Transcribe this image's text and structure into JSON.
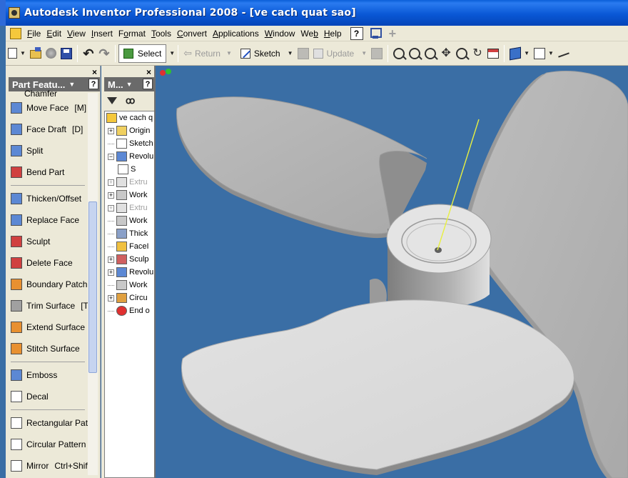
{
  "window": {
    "title": "Autodesk Inventor Professional 2008 - [ve cach quat sao]"
  },
  "menubar": {
    "items": [
      {
        "label": "File",
        "key": "F"
      },
      {
        "label": "Edit",
        "key": "E"
      },
      {
        "label": "View",
        "key": "V"
      },
      {
        "label": "Insert",
        "key": "I"
      },
      {
        "label": "Format",
        "key": "o"
      },
      {
        "label": "Tools",
        "key": "T"
      },
      {
        "label": "Convert",
        "key": "C"
      },
      {
        "label": "Applications",
        "key": "A"
      },
      {
        "label": "Window",
        "key": "W"
      },
      {
        "label": "Web",
        "key": "b"
      },
      {
        "label": "Help",
        "key": "H"
      }
    ],
    "help_button": "?"
  },
  "toolbar": {
    "select_label": "Select",
    "return_label": "Return",
    "sketch_label": "Sketch",
    "update_label": "Update"
  },
  "part_features": {
    "header": "Part Featu...",
    "help": "?",
    "partial_top": "Chamfer    Ctrl+Sh",
    "groups": [
      [
        {
          "label": "Move Face",
          "shortcut": "[M]",
          "icon": "move-face-icon",
          "color": "blue"
        },
        {
          "label": "Face Draft",
          "shortcut": "[D]",
          "icon": "face-draft-icon",
          "color": "blue"
        },
        {
          "label": "Split",
          "shortcut": "",
          "icon": "split-icon",
          "color": "blue"
        },
        {
          "label": "Bend Part",
          "shortcut": "",
          "icon": "bend-part-icon",
          "color": "red"
        }
      ],
      [
        {
          "label": "Thicken/Offset",
          "shortcut": "",
          "icon": "thicken-offset-icon",
          "color": "blue"
        },
        {
          "label": "Replace Face",
          "shortcut": "",
          "icon": "replace-face-icon",
          "color": "blue"
        },
        {
          "label": "Sculpt",
          "shortcut": "",
          "icon": "sculpt-icon",
          "color": "red"
        },
        {
          "label": "Delete Face",
          "shortcut": "",
          "icon": "delete-face-icon",
          "color": "red"
        },
        {
          "label": "Boundary Patch",
          "shortcut": "",
          "icon": "boundary-patch-icon",
          "color": "orange"
        },
        {
          "label": "Trim Surface",
          "shortcut": "[T]",
          "icon": "trim-surface-icon",
          "color": "gray"
        },
        {
          "label": "Extend Surface",
          "shortcut": "",
          "icon": "extend-surface-icon",
          "color": "orange"
        },
        {
          "label": "Stitch Surface",
          "shortcut": "",
          "icon": "stitch-surface-icon",
          "color": "orange"
        }
      ],
      [
        {
          "label": "Emboss",
          "shortcut": "",
          "icon": "emboss-icon",
          "color": "blue"
        },
        {
          "label": "Decal",
          "shortcut": "",
          "icon": "decal-icon",
          "color": "white"
        }
      ],
      [
        {
          "label": "Rectangular Patte",
          "shortcut": "",
          "icon": "rectangular-pattern-icon",
          "color": "white"
        },
        {
          "label": "Circular Pattern",
          "shortcut": "",
          "icon": "circular-pattern-icon",
          "color": "white"
        },
        {
          "label": "Mirror",
          "shortcut": "Ctrl+Shift",
          "icon": "mirror-icon",
          "color": "white"
        }
      ]
    ]
  },
  "browser": {
    "header": "M...",
    "help": "?",
    "items": [
      {
        "label": "ve cach q",
        "icon": "doc",
        "expander": "none",
        "dim": false,
        "sub": false
      },
      {
        "label": "Origin",
        "icon": "folder",
        "expander": "+",
        "dim": false,
        "sub": false
      },
      {
        "label": "Sketch",
        "icon": "sketch",
        "expander": "none",
        "dim": false,
        "sub": false
      },
      {
        "label": "Revolu",
        "icon": "revolve",
        "expander": "-",
        "dim": false,
        "sub": false
      },
      {
        "label": "S",
        "icon": "sketch",
        "expander": "",
        "dim": false,
        "sub": true
      },
      {
        "label": "Extru",
        "icon": "extrude",
        "expander": "+",
        "dim": true,
        "sub": false
      },
      {
        "label": "Work",
        "icon": "work",
        "expander": "+",
        "dim": false,
        "sub": false
      },
      {
        "label": "Extru",
        "icon": "extrude",
        "expander": "+",
        "dim": true,
        "sub": false
      },
      {
        "label": "Work",
        "icon": "work",
        "expander": "none",
        "dim": false,
        "sub": false
      },
      {
        "label": "Thick",
        "icon": "thick",
        "expander": "none",
        "dim": false,
        "sub": false
      },
      {
        "label": "FaceI",
        "icon": "face",
        "expander": "none",
        "dim": false,
        "sub": false
      },
      {
        "label": "Sculp",
        "icon": "sculpt",
        "expander": "+",
        "dim": false,
        "sub": false
      },
      {
        "label": "Revolu",
        "icon": "revolve",
        "expander": "+",
        "dim": false,
        "sub": false
      },
      {
        "label": "Work",
        "icon": "work",
        "expander": "none",
        "dim": false,
        "sub": false
      },
      {
        "label": "Circu",
        "icon": "circ",
        "expander": "+",
        "dim": false,
        "sub": false
      },
      {
        "label": "End o",
        "icon": "end",
        "expander": "none",
        "dim": false,
        "sub": false
      }
    ]
  },
  "viewport": {
    "background": "#3a6ea5",
    "model": "propeller"
  },
  "colors": {
    "title_bar": "#0a58d6",
    "chrome": "#ece9d8",
    "viewport": "#3a6ea5",
    "blade": "#d8d8d8",
    "axis_line": "#e8f040"
  }
}
